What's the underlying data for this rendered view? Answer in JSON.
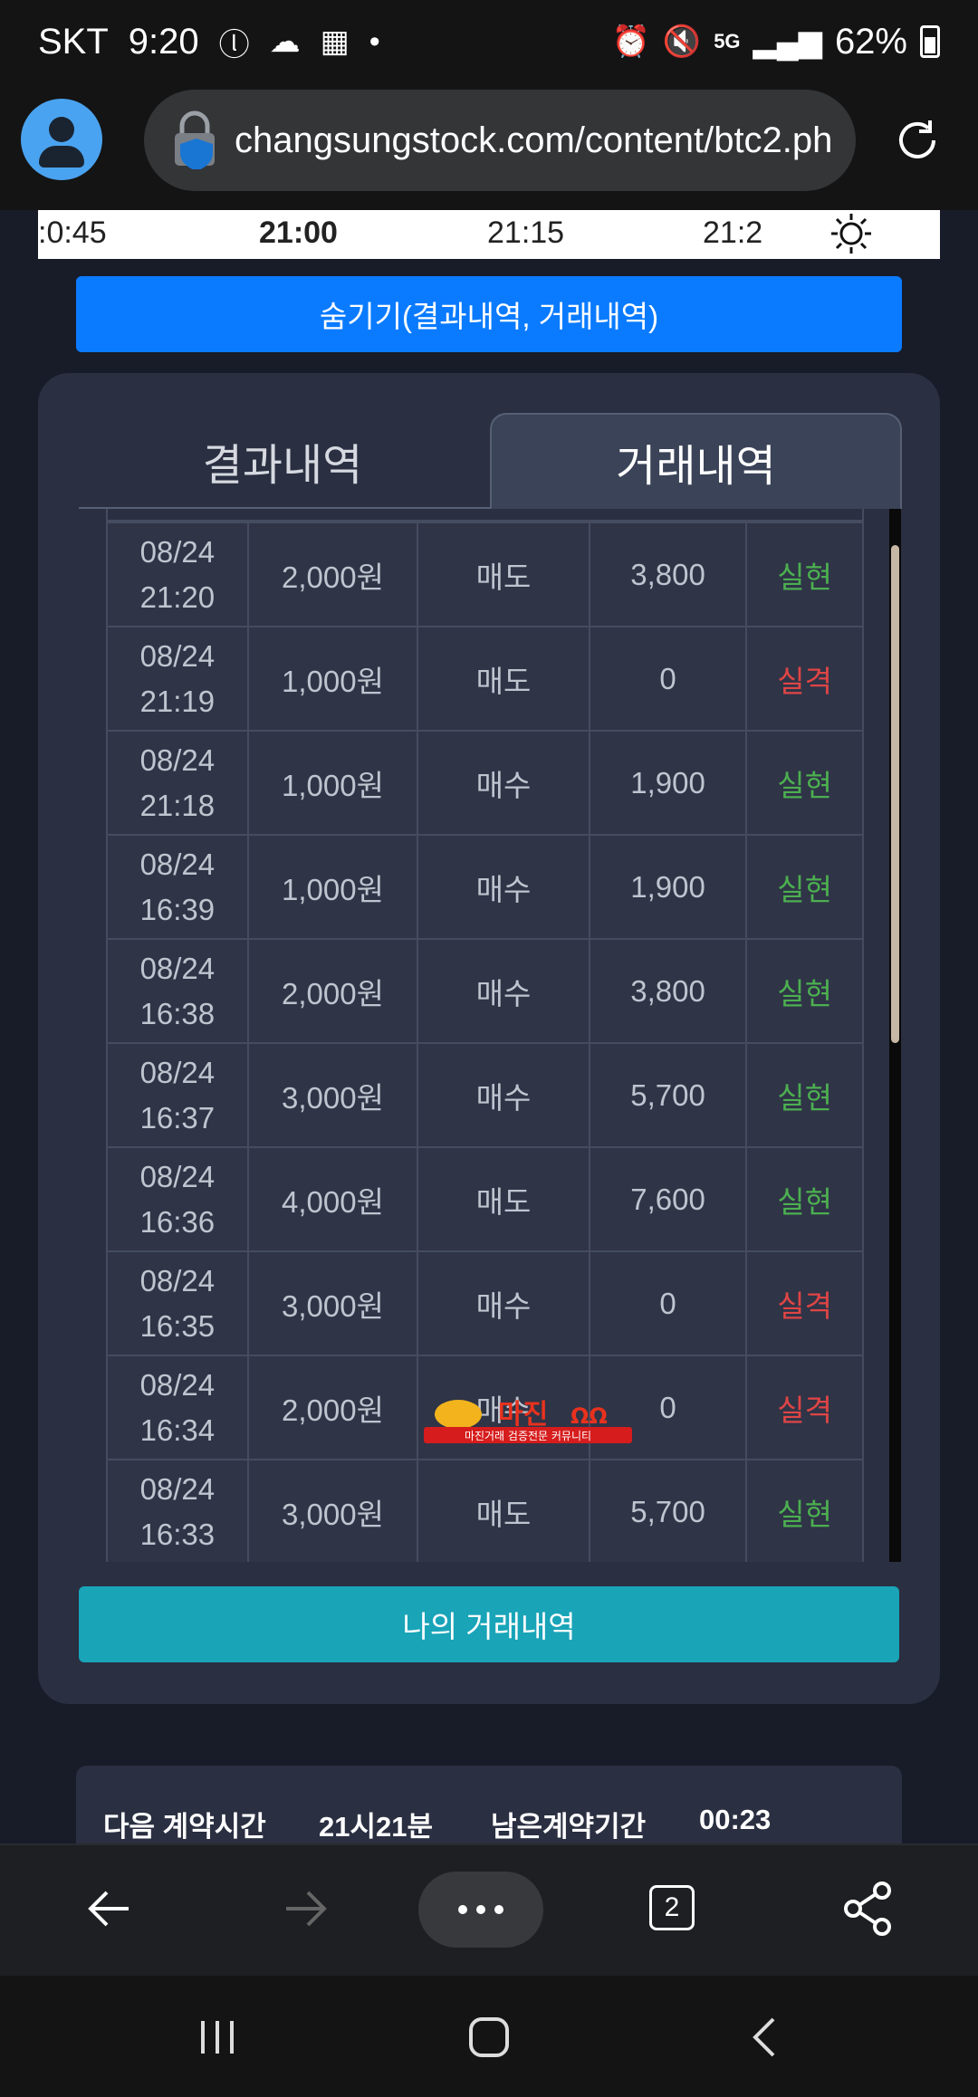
{
  "status": {
    "carrier": "SKT",
    "time": "9:20",
    "battery": "62%",
    "network": "5G"
  },
  "browser": {
    "url": "changsungstock.com/content/btc2.ph",
    "tabs_count": "2"
  },
  "timeline": {
    "labels": [
      ":0:45",
      "21:00",
      "21:15",
      "21:2"
    ]
  },
  "hide_button": "숨기기(결과내역, 거래내역)",
  "tabs": {
    "results": "결과내역",
    "trades": "거래내역"
  },
  "rows": [
    {
      "date": "08/24",
      "time": "21:20",
      "amount": "2,000원",
      "side": "매도",
      "value": "3,800",
      "result": "실현"
    },
    {
      "date": "08/24",
      "time": "21:19",
      "amount": "1,000원",
      "side": "매도",
      "value": "0",
      "result": "실격"
    },
    {
      "date": "08/24",
      "time": "21:18",
      "amount": "1,000원",
      "side": "매수",
      "value": "1,900",
      "result": "실현"
    },
    {
      "date": "08/24",
      "time": "16:39",
      "amount": "1,000원",
      "side": "매수",
      "value": "1,900",
      "result": "실현"
    },
    {
      "date": "08/24",
      "time": "16:38",
      "amount": "2,000원",
      "side": "매수",
      "value": "3,800",
      "result": "실현"
    },
    {
      "date": "08/24",
      "time": "16:37",
      "amount": "3,000원",
      "side": "매수",
      "value": "5,700",
      "result": "실현"
    },
    {
      "date": "08/24",
      "time": "16:36",
      "amount": "4,000원",
      "side": "매도",
      "value": "7,600",
      "result": "실현"
    },
    {
      "date": "08/24",
      "time": "16:35",
      "amount": "3,000원",
      "side": "매수",
      "value": "0",
      "result": "실격"
    },
    {
      "date": "08/24",
      "time": "16:34",
      "amount": "2,000원",
      "side": "매수",
      "value": "0",
      "result": "실격"
    },
    {
      "date": "08/24",
      "time": "16:33",
      "amount": "3,000원",
      "side": "매도",
      "value": "5,700",
      "result": "실현"
    }
  ],
  "watermark": {
    "brand": "마진",
    "tagline": "마진거래 검증전문 커뮤니티"
  },
  "my_trades_button": "나의 거래내역",
  "info": {
    "next_label": "다음 계약시간",
    "next_value": "21시21분",
    "remain_label": "남은계약기간",
    "remain_value": "00:23"
  },
  "colors": {
    "accent_blue": "#0a7bff",
    "teal": "#19a4b8",
    "success": "#4caf50",
    "fail": "#e04545"
  }
}
